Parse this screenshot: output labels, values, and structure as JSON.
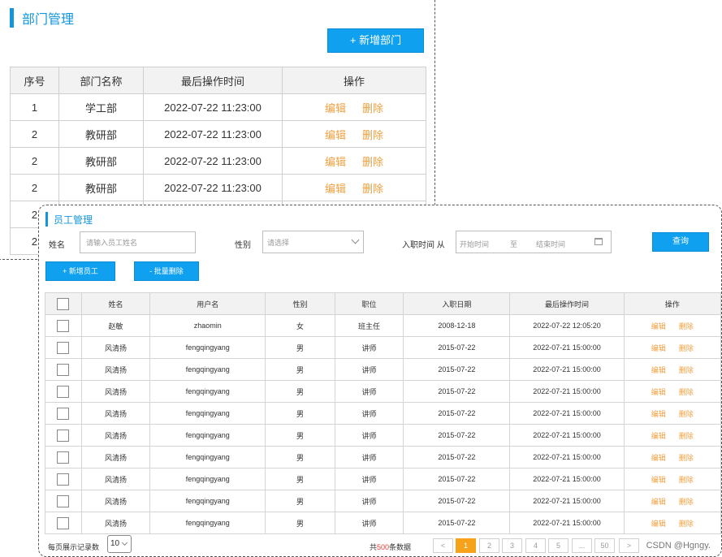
{
  "dept": {
    "title": "部门管理",
    "add_button": "+ 新增部门",
    "columns": [
      "序号",
      "部门名称",
      "最后操作时间",
      "操作"
    ],
    "rows": [
      {
        "no": "1",
        "name": "学工部",
        "time": "2022-07-22 11:23:00"
      },
      {
        "no": "2",
        "name": "教研部",
        "time": "2022-07-22 11:23:00"
      },
      {
        "no": "2",
        "name": "教研部",
        "time": "2022-07-22 11:23:00"
      },
      {
        "no": "2",
        "name": "教研部",
        "time": "2022-07-22 11:23:00"
      },
      {
        "no": "2",
        "name": "",
        "time": ""
      },
      {
        "no": "2",
        "name": "",
        "time": ""
      }
    ],
    "edit": "编辑",
    "delete": "删除"
  },
  "emp": {
    "title": "员工管理",
    "search": {
      "name_label": "姓名",
      "name_placeholder": "请输入员工姓名",
      "gender_label": "性别",
      "gender_placeholder": "请选择",
      "date_label": "入职时间 从",
      "date_start": "开始时间",
      "date_to": "至",
      "date_end": "结束时间",
      "query_button": "查询"
    },
    "add_button": "+ 新增员工",
    "batch_delete_button": "- 批量删除",
    "columns": [
      "姓名",
      "用户名",
      "性别",
      "职位",
      "入职日期",
      "最后操作时间",
      "操作"
    ],
    "rows": [
      {
        "name": "赵敏",
        "username": "zhaomin",
        "gender": "女",
        "position": "班主任",
        "entry": "2008-12-18",
        "time": "2022-07-22 12:05:20"
      },
      {
        "name": "风清扬",
        "username": "fengqingyang",
        "gender": "男",
        "position": "讲师",
        "entry": "2015-07-22",
        "time": "2022-07-21 15:00:00"
      },
      {
        "name": "风清扬",
        "username": "fengqingyang",
        "gender": "男",
        "position": "讲师",
        "entry": "2015-07-22",
        "time": "2022-07-21 15:00:00"
      },
      {
        "name": "风清扬",
        "username": "fengqingyang",
        "gender": "男",
        "position": "讲师",
        "entry": "2015-07-22",
        "time": "2022-07-21 15:00:00"
      },
      {
        "name": "风清扬",
        "username": "fengqingyang",
        "gender": "男",
        "position": "讲师",
        "entry": "2015-07-22",
        "time": "2022-07-21 15:00:00"
      },
      {
        "name": "风清扬",
        "username": "fengqingyang",
        "gender": "男",
        "position": "讲师",
        "entry": "2015-07-22",
        "time": "2022-07-21 15:00:00"
      },
      {
        "name": "风清扬",
        "username": "fengqingyang",
        "gender": "男",
        "position": "讲师",
        "entry": "2015-07-22",
        "time": "2022-07-21 15:00:00"
      },
      {
        "name": "风清扬",
        "username": "fengqingyang",
        "gender": "男",
        "position": "讲师",
        "entry": "2015-07-22",
        "time": "2022-07-21 15:00:00"
      },
      {
        "name": "风清扬",
        "username": "fengqingyang",
        "gender": "男",
        "position": "讲师",
        "entry": "2015-07-22",
        "time": "2022-07-21 15:00:00"
      },
      {
        "name": "风清扬",
        "username": "fengqingyang",
        "gender": "男",
        "position": "讲师",
        "entry": "2015-07-22",
        "time": "2022-07-21 15:00:00"
      }
    ],
    "edit": "编辑",
    "delete": "删除",
    "pager": {
      "per_page_label": "每页展示记录数",
      "per_page_value": "10",
      "total_prefix": "共",
      "total_count": "500",
      "total_suffix": "条数据",
      "prev": "<",
      "pages": [
        "1",
        "2",
        "3",
        "4",
        "5",
        "...",
        "50"
      ],
      "next": ">",
      "active_page": "1"
    }
  },
  "watermark": "CSDN @Hgngy.",
  "colors": {
    "primary": "#0fa0f0",
    "accent": "#1296db",
    "link": "#f0a040",
    "active_page": "#f7a21b"
  }
}
